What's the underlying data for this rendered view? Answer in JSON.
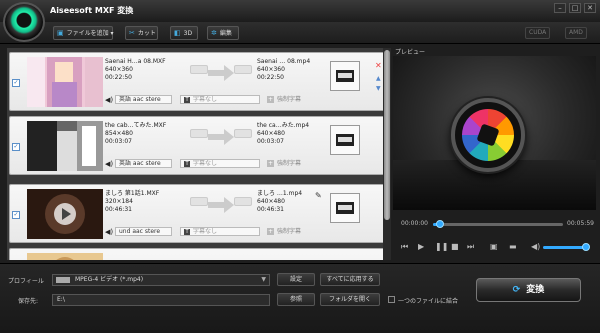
{
  "app": {
    "title": "Aiseesoft MXF 変換"
  },
  "window": {
    "min": "–",
    "max": "□",
    "close": "✕"
  },
  "toolbar": {
    "add_file": "ファイルを追加",
    "cut": "カット",
    "threed": "3D",
    "edit": "編集",
    "cuda": "CUDA",
    "amd": "AMD"
  },
  "files": [
    {
      "src_name": "Saenai H…a 08.MXF",
      "src_res": "640×360",
      "src_dur": "00:22:50",
      "dst_name": "Saenai … 08.mp4",
      "dst_res": "640×360",
      "dst_dur": "00:22:50",
      "audio": "英語 aac stere",
      "subtitle": "字幕なし",
      "add_sub": "強制字幕",
      "thumb_color": "#f0c8d8"
    },
    {
      "src_name": "the cab…てみた.MXF",
      "src_res": "854×480",
      "src_dur": "00:03:07",
      "dst_name": "the ca…みた.mp4",
      "dst_res": "640×480",
      "dst_dur": "00:03:07",
      "audio": "英語 aac stere",
      "subtitle": "字幕なし",
      "add_sub": "強制字幕",
      "thumb_color": "#333"
    },
    {
      "src_name": "ましろ 第1話1.MXF",
      "src_res": "320×184",
      "src_dur": "00:46:31",
      "dst_name": "ましろ …1.mp4",
      "dst_res": "640×480",
      "dst_dur": "00:46:31",
      "audio": "und aac stere",
      "subtitle": "字幕なし",
      "add_sub": "強制字幕",
      "thumb_color": "#3a2218"
    },
    {
      "src_name": "",
      "src_res": "",
      "src_dur": "",
      "dst_name": "",
      "dst_res": "",
      "dst_dur": "",
      "audio": "",
      "subtitle": "",
      "add_sub": "",
      "thumb_color": "#d8b070"
    }
  ],
  "preview": {
    "label": "プレビュー",
    "time_start": "00:00:00",
    "time_end": "00:05:59",
    "progress": 0.05,
    "volume": 0.85
  },
  "bottom": {
    "profile_label": "プロフィール",
    "profile_value": "MPEG-4 ビデオ (*.mp4)",
    "dest_label": "保存先:",
    "dest_value": "E:\\",
    "settings": "設定",
    "apply_all": "すべてに応用する",
    "browse": "参照",
    "open_folder": "フォルダを開く",
    "merge": "一つのファイルに結合",
    "convert": "変換"
  }
}
